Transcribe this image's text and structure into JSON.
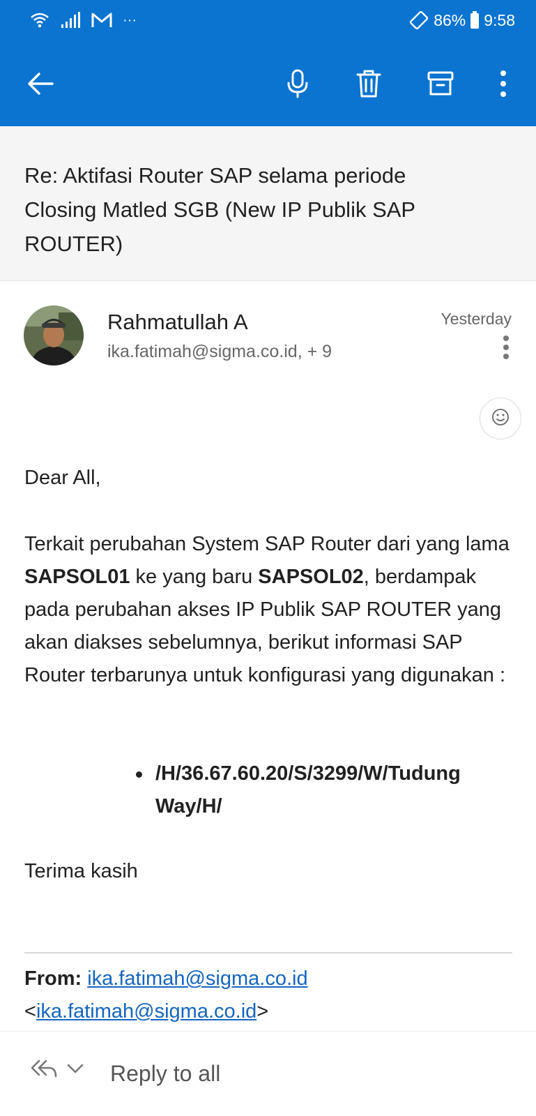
{
  "status_bar": {
    "battery": "86%",
    "time": "9:58",
    "more": "···"
  },
  "toolbar": {
    "back_icon": "arrow-back-icon",
    "mic_icon": "microphone-icon",
    "delete_icon": "trash-icon",
    "archive_icon": "archive-icon",
    "more_icon": "more-vert-icon",
    "accent_color": "#0a74d0"
  },
  "email": {
    "subject": "Re: Aktifasi Router SAP selama periode Closing Matled SGB (New IP Publik SAP ROUTER)",
    "sender_name": "Rahmatullah A",
    "recipients": "ika.fatimah@sigma.co.id, + 9",
    "date": "Yesterday",
    "greeting": "Dear All,",
    "para_1": "Terkait perubahan System SAP Router dari yang lama ",
    "old_system": "SAPSOL01",
    "para_2": " ke yang baru ",
    "new_system": "SAPSOL02",
    "para_3": ", berdampak pada perubahan akses IP Publik SAP ROUTER yang akan diakses sebelumnya, berikut informasi SAP Router terbarunya untuk konfigurasi yang digunakan :",
    "router_string": "/H/36.67.60.20/S/3299/W/Tudung Way/H/",
    "closing": "Terima kasih",
    "from_label": "From:",
    "from_email": "ika.fatimah@sigma.co.id",
    "from_lt": "<",
    "from_email_2": "ika.fatimah@sigma.co.id",
    "from_gt": ">"
  },
  "bottom_bar": {
    "reply_label": "Reply to all"
  }
}
